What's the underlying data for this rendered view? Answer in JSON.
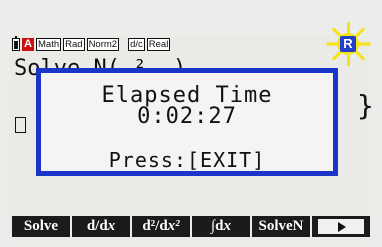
{
  "status_bar": {
    "alpha": "A",
    "math": "Math",
    "rad": "Rad",
    "norm": "Norm2",
    "frac": "d/c",
    "real": "Real",
    "indicator": "R",
    "indicator_color": "#2040c8",
    "highlight_color": "#f6e310"
  },
  "background_text": {
    "line1": "Solve N( ² -)",
    "brace": "}"
  },
  "dialog": {
    "title": "Elapsed Time",
    "elapsed": "0:02:27",
    "prompt": "Press:[EXIT]",
    "border_color": "#1a35c8"
  },
  "function_keys": {
    "f1": "Solve",
    "f2_a": "d/d",
    "f2_b": "x",
    "f3_a": "d²/d",
    "f3_b": "x²",
    "f4_a": "∫d",
    "f4_b": "x",
    "f5": "SolveN",
    "f6_icon": "right-arrow-icon"
  }
}
